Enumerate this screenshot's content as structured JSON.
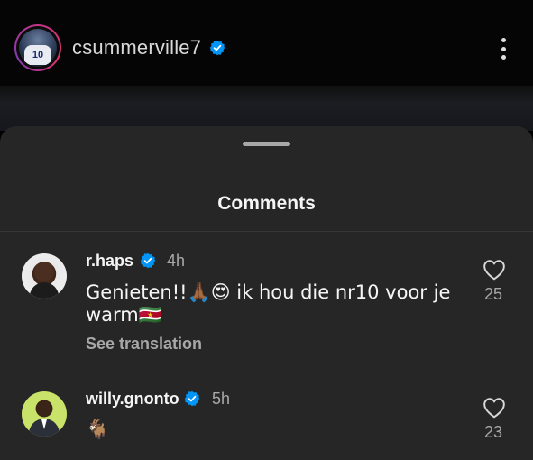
{
  "header": {
    "username": "csummerville7",
    "avatar_jersey_number": "10"
  },
  "sheet": {
    "title": "Comments"
  },
  "comments": [
    {
      "username": "r.haps",
      "time": "4h",
      "text_line1": "Genieten!!🙏🏾😍 ik hou die nr10 voor je",
      "text_line2": "warm🇸🇷",
      "translate_label": "See translation",
      "likes": "25"
    },
    {
      "username": "willy.gnonto",
      "time": "5h",
      "text_line1": "🐐",
      "likes": "23"
    }
  ],
  "colors": {
    "background": "#262626",
    "verified_blue": "#0095f6",
    "secondary_text": "#a8a8a8"
  },
  "icons": [
    "verified-badge-icon",
    "more-options-icon",
    "heart-icon"
  ]
}
